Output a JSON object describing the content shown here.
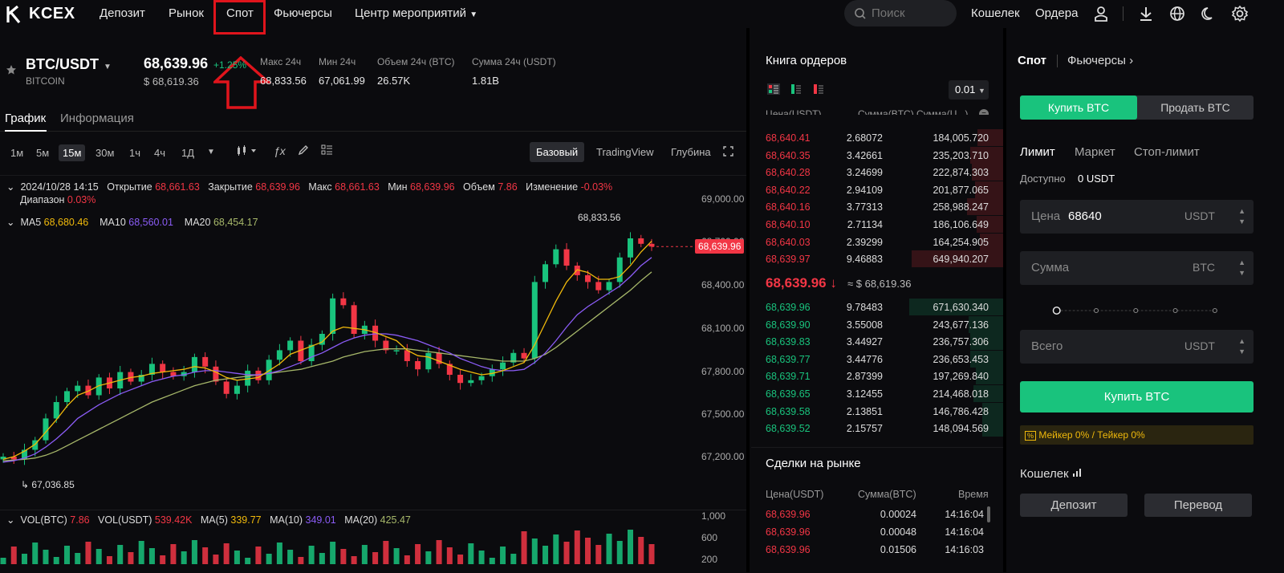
{
  "brand": {
    "name": "KCEX"
  },
  "nav": {
    "items": [
      "Депозит",
      "Рынок",
      "Спот",
      "Фьючерсы",
      "Центр мероприятий"
    ],
    "search_placeholder": "Поиск",
    "wallet": "Кошелек",
    "orders": "Ордера"
  },
  "ticker": {
    "pair": "BTC/USDT",
    "name": "BITCOIN",
    "price": "68,639.96",
    "change": "+1.25%",
    "usd_price": "$ 68,619.36",
    "stats": [
      {
        "label": "Макс 24ч",
        "value": "68,833.56"
      },
      {
        "label": "Мин 24ч",
        "value": "67,061.99"
      },
      {
        "label": "Объем 24ч (BTC)",
        "value": "26.57K"
      },
      {
        "label": "Сумма 24ч (USDT)",
        "value": "1.81B"
      }
    ]
  },
  "tabs": [
    "График",
    "Информация"
  ],
  "timeframes": [
    "1м",
    "5м",
    "15м",
    "30м",
    "1ч",
    "4ч",
    "1Д"
  ],
  "selected_timeframe": "15м",
  "views": [
    "Базовый",
    "TradingView",
    "Глубина"
  ],
  "ohlc": {
    "date": "2024/10/28 14:15",
    "open_label": "Открытие",
    "open": "68,661.63",
    "close_label": "Закрытие",
    "close": "68,639.96",
    "high_label": "Макс",
    "high": "68,661.63",
    "low_label": "Мин",
    "low": "68,639.96",
    "volume_label": "Объем",
    "volume": "7.86",
    "change_label": "Изменение",
    "change": "-0.03%",
    "range_label": "Диапазон",
    "range": "0.03%"
  },
  "ma": {
    "ma5_label": "MA5",
    "ma5": "68,680.46",
    "ma10_label": "MA10",
    "ma10": "68,560.01",
    "ma20_label": "MA20",
    "ma20": "68,454.17"
  },
  "vol": {
    "btc_label": "VOL(BTC)",
    "btc": "7.86",
    "usdt_label": "VOL(USDT)",
    "usdt": "539.42K",
    "ma5_label": "MA(5)",
    "ma5": "339.77",
    "ma10_label": "MA(10)",
    "ma10": "349.01",
    "ma20_label": "MA(20)",
    "ma20": "425.47"
  },
  "chart_data": {
    "type": "candlestick",
    "y_axis_ticks": [
      "69,000.00",
      "68,700.00",
      "68,400.00",
      "68,100.00",
      "67,800.00",
      "67,500.00",
      "67,200.00"
    ],
    "volume_axis_ticks": [
      "1,000",
      "600",
      "200"
    ],
    "current_price": "68,639.96",
    "high_marker": "68,833.56",
    "low_marker": "67,036.85",
    "closes": [
      67100,
      67080,
      67150,
      67220,
      67380,
      67500,
      67580,
      67620,
      67550,
      67680,
      67600,
      67720,
      67650,
      67700,
      67780,
      67720,
      67690,
      67720,
      67830,
      67760,
      67650,
      67560,
      67620,
      67730,
      67660,
      67810,
      67880,
      67950,
      67800,
      67920,
      68000,
      68260,
      68210,
      68000,
      68060,
      67950,
      67880,
      67880,
      67800,
      67740,
      67860,
      67780,
      67700,
      67640,
      67660,
      67690,
      67740,
      67790,
      67860,
      67820,
      68380,
      68510,
      68620,
      68500,
      68430,
      68380,
      68320,
      68380,
      68560,
      68700,
      68660,
      68640
    ],
    "ma5": [
      67080,
      67100,
      67140,
      67190,
      67280,
      67370,
      67470,
      67550,
      67580,
      67620,
      67640,
      67660,
      67680,
      67690,
      67710,
      67720,
      67730,
      67740,
      67760,
      67750,
      67720,
      67680,
      67660,
      67670,
      67680,
      67730,
      67780,
      67850,
      67880,
      67910,
      67940,
      68020,
      68050,
      68040,
      68030,
      68010,
      67980,
      67950,
      67880,
      67840,
      67830,
      67800,
      67770,
      67740,
      67720,
      67700,
      67710,
      67730,
      67760,
      67790,
      67920,
      68080,
      68240,
      68380,
      68470,
      68450,
      68400,
      68400,
      68420,
      68500,
      68600,
      68680
    ],
    "ma10": [
      67060,
      67070,
      67090,
      67120,
      67170,
      67230,
      67300,
      67380,
      67430,
      67480,
      67520,
      67560,
      67590,
      67620,
      67650,
      67670,
      67690,
      67700,
      67720,
      67730,
      67730,
      67720,
      67710,
      67700,
      67700,
      67710,
      67730,
      67760,
      67790,
      67830,
      67860,
      67900,
      67940,
      67970,
      67990,
      68000,
      68000,
      67990,
      67970,
      67950,
      67920,
      67890,
      67860,
      67820,
      67790,
      67760,
      67740,
      67730,
      67730,
      67740,
      67790,
      67860,
      67950,
      68050,
      68140,
      68200,
      68250,
      68300,
      68350,
      68420,
      68500,
      68560
    ],
    "ma20": [
      67070,
      67075,
      67080,
      67090,
      67110,
      67140,
      67180,
      67220,
      67260,
      67300,
      67340,
      67380,
      67420,
      67460,
      67500,
      67530,
      67560,
      67590,
      67620,
      67640,
      67660,
      67670,
      67680,
      67690,
      67700,
      67710,
      67720,
      67730,
      67740,
      67760,
      67780,
      67800,
      67830,
      67850,
      67870,
      67880,
      67890,
      67890,
      67890,
      67880,
      67870,
      67860,
      67850,
      67840,
      67830,
      67820,
      67810,
      67800,
      67800,
      67800,
      67820,
      67850,
      67900,
      67960,
      68020,
      68080,
      68140,
      68200,
      68260,
      68320,
      68390,
      68454
    ]
  },
  "orderbook": {
    "title": "Книга ордеров",
    "precision": "0.01",
    "headers": [
      "Цена(USDT)",
      "Сумма(BTC)",
      "Сумма(U...)"
    ],
    "asks": [
      [
        "68,640.41",
        "2.68072",
        "184,005.720"
      ],
      [
        "68,640.35",
        "3.42661",
        "235,203.710"
      ],
      [
        "68,640.28",
        "3.24699",
        "222,874.303"
      ],
      [
        "68,640.22",
        "2.94109",
        "201,877.065"
      ],
      [
        "68,640.16",
        "3.77313",
        "258,988.247"
      ],
      [
        "68,640.10",
        "2.71134",
        "186,106.649"
      ],
      [
        "68,640.03",
        "2.39299",
        "164,254.905"
      ],
      [
        "68,639.97",
        "9.46883",
        "649,940.207"
      ]
    ],
    "last_price": "68,639.96",
    "last_usd": "≈ $ 68,619.36",
    "bids": [
      [
        "68,639.96",
        "9.78483",
        "671,630.340"
      ],
      [
        "68,639.90",
        "3.55008",
        "243,677.136"
      ],
      [
        "68,639.83",
        "3.44927",
        "236,757.306"
      ],
      [
        "68,639.77",
        "3.44776",
        "236,653.453"
      ],
      [
        "68,639.71",
        "2.87399",
        "197,269.840"
      ],
      [
        "68,639.65",
        "3.12455",
        "214,468.018"
      ],
      [
        "68,639.58",
        "2.13851",
        "146,786.428"
      ],
      [
        "68,639.52",
        "2.15757",
        "148,094.569"
      ]
    ]
  },
  "trades": {
    "title": "Сделки на рынке",
    "headers": [
      "Цена(USDT)",
      "Сумма(BTC)",
      "Время"
    ],
    "rows": [
      [
        "68,639.96",
        "0.00024",
        "14:16:04"
      ],
      [
        "68,639.96",
        "0.00048",
        "14:16:04"
      ],
      [
        "68,639.96",
        "0.01506",
        "14:16:03"
      ]
    ]
  },
  "panel": {
    "tab_spot": "Спот",
    "tab_futures": "Фьючерсы",
    "buy": "Купить BTC",
    "sell": "Продать BTC",
    "order_types": [
      "Лимит",
      "Маркет",
      "Стоп-лимит"
    ],
    "available_label": "Доступно",
    "available": "0 USDT",
    "price_label": "Цена",
    "price_value": "68640",
    "price_unit": "USDT",
    "amount_label": "Сумма",
    "amount_unit": "BTC",
    "total_label": "Всего",
    "total_unit": "USDT",
    "buy_button": "Купить BTC",
    "fee": "Мейкер 0% / Тейкер 0%",
    "wallet_title": "Кошелек",
    "deposit": "Депозит",
    "transfer": "Перевод"
  },
  "colors": {
    "up": "#19c37d",
    "down": "#f23645",
    "highlight": "#e0141c"
  }
}
